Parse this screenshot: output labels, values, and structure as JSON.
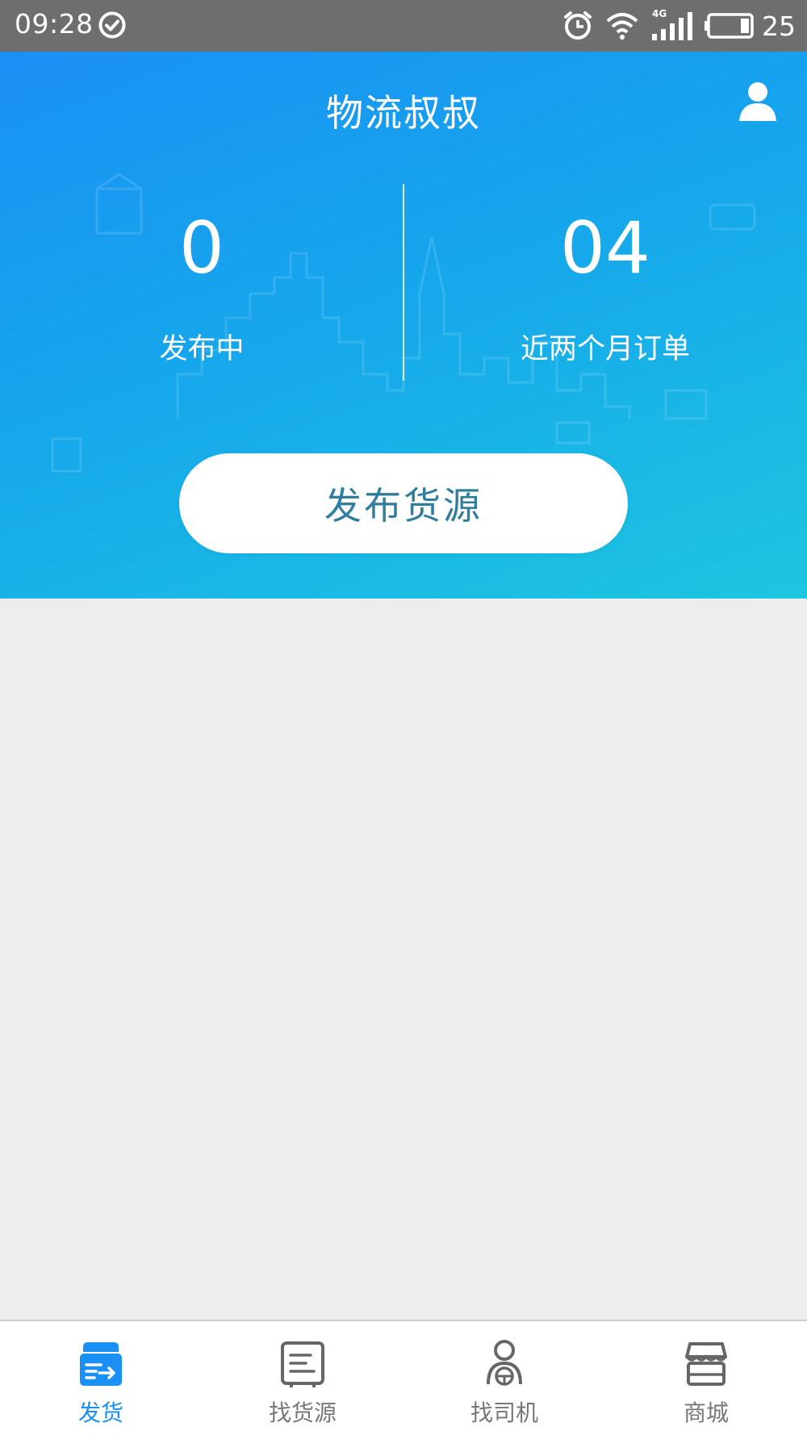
{
  "status_bar": {
    "time": "09:28",
    "network": "4G",
    "battery": "25"
  },
  "header": {
    "title": "物流叔叔",
    "stats": [
      {
        "value": "0",
        "label": "发布中"
      },
      {
        "value": "04",
        "label": "近两个月订单"
      }
    ],
    "publish_button": "发布货源"
  },
  "bottom_nav": [
    {
      "label": "发货",
      "icon": "shipping-box-icon",
      "active": true
    },
    {
      "label": "找货源",
      "icon": "document-list-icon",
      "active": false
    },
    {
      "label": "找司机",
      "icon": "driver-icon",
      "active": false
    },
    {
      "label": "商城",
      "icon": "store-icon",
      "active": false
    }
  ],
  "colors": {
    "primary": "#1a90f4",
    "gradient_end": "#1dc6df",
    "button_text": "#2f7e9d",
    "background": "#ededed"
  }
}
